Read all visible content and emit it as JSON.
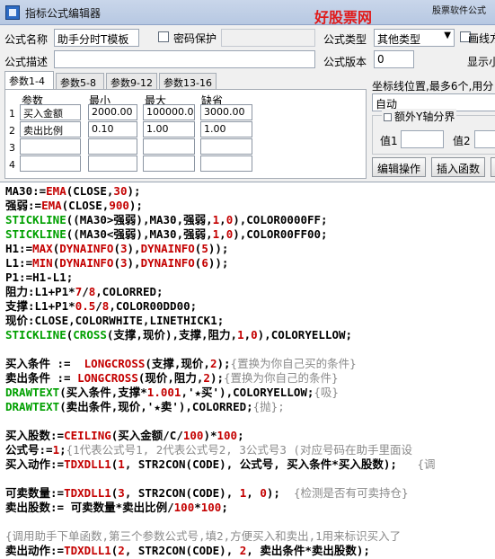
{
  "window": {
    "title": "指标公式编辑器",
    "brand_top": "股票软件公式",
    "brand": "好股票网Goodgupiao.com"
  },
  "form": {
    "name_label": "公式名称",
    "name_value": "助手分时T模板",
    "password_label": "密码保护",
    "type_label": "公式类型",
    "type_value": "其他类型",
    "draw_label": "画线方",
    "desc_label": "公式描述",
    "version_label": "公式版本",
    "version_value": "0",
    "display_label": "显示小"
  },
  "tabs": [
    "参数1-4",
    "参数5-8",
    "参数9-12",
    "参数13-16"
  ],
  "params": {
    "headers": [
      "参数",
      "最小",
      "最大",
      "缺省"
    ],
    "rows": [
      {
        "num": "1",
        "name": "买入金额",
        "min": "2000.00",
        "max": "100000.00",
        "default": "3000.00"
      },
      {
        "num": "2",
        "name": "卖出比例",
        "min": "0.10",
        "max": "1.00",
        "default": "1.00"
      },
      {
        "num": "3",
        "name": "",
        "min": "",
        "max": "",
        "default": ""
      },
      {
        "num": "4",
        "name": "",
        "min": "",
        "max": "",
        "default": ""
      }
    ]
  },
  "axis": {
    "label": "坐标线位置,最多6个,用分",
    "value": "自动",
    "group_label": "额外Y轴分界",
    "val1_label": "值1",
    "val2_label": "值2"
  },
  "buttons": {
    "edit_ops": "编辑操作",
    "insert_fn": "插入函数"
  },
  "code": [
    [
      [
        "MA30:=",
        "k"
      ],
      [
        "EMA",
        "f"
      ],
      [
        "(CLOSE,",
        "k"
      ],
      [
        "30",
        "n"
      ],
      [
        ");",
        "k"
      ]
    ],
    [
      [
        "强弱:=",
        "k"
      ],
      [
        "EMA",
        "f"
      ],
      [
        "(CLOSE,",
        "k"
      ],
      [
        "900",
        "n"
      ],
      [
        ");",
        "k"
      ]
    ],
    [
      [
        "STICKLINE",
        "g"
      ],
      [
        "((MA30>强弱),MA30,强弱,",
        "k"
      ],
      [
        "1",
        "n"
      ],
      [
        ",",
        "k"
      ],
      [
        "0",
        "n"
      ],
      [
        "),COLOR0000FF;",
        "k"
      ]
    ],
    [
      [
        "STICKLINE",
        "g"
      ],
      [
        "((MA30<强弱),MA30,强弱,",
        "k"
      ],
      [
        "1",
        "n"
      ],
      [
        ",",
        "k"
      ],
      [
        "0",
        "n"
      ],
      [
        "),COLOR00FF00;",
        "k"
      ]
    ],
    [
      [
        "H1:=",
        "k"
      ],
      [
        "MAX",
        "f"
      ],
      [
        "(",
        "k"
      ],
      [
        "DYNAINFO",
        "f"
      ],
      [
        "(",
        "k"
      ],
      [
        "3",
        "n"
      ],
      [
        "),",
        "k"
      ],
      [
        "DYNAINFO",
        "f"
      ],
      [
        "(",
        "k"
      ],
      [
        "5",
        "n"
      ],
      [
        "));",
        "k"
      ]
    ],
    [
      [
        "L1:=",
        "k"
      ],
      [
        "MIN",
        "f"
      ],
      [
        "(",
        "k"
      ],
      [
        "DYNAINFO",
        "f"
      ],
      [
        "(",
        "k"
      ],
      [
        "3",
        "n"
      ],
      [
        "),",
        "k"
      ],
      [
        "DYNAINFO",
        "f"
      ],
      [
        "(",
        "k"
      ],
      [
        "6",
        "n"
      ],
      [
        "));",
        "k"
      ]
    ],
    [
      [
        "P1:=H1-L1;",
        "k"
      ]
    ],
    [
      [
        "阻力:L1+P1*",
        "k"
      ],
      [
        "7",
        "n"
      ],
      [
        "/",
        "k"
      ],
      [
        "8",
        "n"
      ],
      [
        ",COLORRED;",
        "k"
      ]
    ],
    [
      [
        "支撑:L1+P1*",
        "k"
      ],
      [
        "0.5",
        "n"
      ],
      [
        "/",
        "k"
      ],
      [
        "8",
        "n"
      ],
      [
        ",COLOR00DD00;",
        "k"
      ]
    ],
    [
      [
        "现价:CLOSE,COLORWHITE,LINETHICK1;",
        "k"
      ]
    ],
    [
      [
        "STICKLINE",
        "g"
      ],
      [
        "(",
        "k"
      ],
      [
        "CROSS",
        "g"
      ],
      [
        "(支撑,现价),支撑,阻力,",
        "k"
      ],
      [
        "1",
        "n"
      ],
      [
        ",",
        "k"
      ],
      [
        "0",
        "n"
      ],
      [
        "),COLORYELLOW;",
        "k"
      ]
    ],
    [],
    [
      [
        "买入条件 :=  ",
        "k"
      ],
      [
        "LONGCROSS",
        "f"
      ],
      [
        "(支撑,现价,",
        "k"
      ],
      [
        "2",
        "n"
      ],
      [
        ");",
        "k"
      ],
      [
        "{置换为你自己买的条件}",
        "c"
      ]
    ],
    [
      [
        "卖出条件 := ",
        "k"
      ],
      [
        "LONGCROSS",
        "f"
      ],
      [
        "(现价,阻力,",
        "k"
      ],
      [
        "2",
        "n"
      ],
      [
        ");",
        "k"
      ],
      [
        "{置换为你自己的条件}",
        "c"
      ]
    ],
    [
      [
        "DRAWTEXT",
        "g"
      ],
      [
        "(买入条件,支撑*",
        "k"
      ],
      [
        "1.001",
        "n"
      ],
      [
        ",'★买'),COLORYELLOW;",
        "k"
      ],
      [
        "{吸}",
        "c"
      ]
    ],
    [
      [
        "DRAWTEXT",
        "g"
      ],
      [
        "(卖出条件,现价,'★卖'),COLORRED;",
        "k"
      ],
      [
        "{抛};",
        "c"
      ]
    ],
    [],
    [
      [
        "买入股数:=",
        "k"
      ],
      [
        "CEILING",
        "f"
      ],
      [
        "(买入金额/C/",
        "k"
      ],
      [
        "100",
        "n"
      ],
      [
        ")*",
        "k"
      ],
      [
        "100",
        "n"
      ],
      [
        ";",
        "k"
      ]
    ],
    [
      [
        "公式号:=",
        "k"
      ],
      [
        "1",
        "n"
      ],
      [
        ";",
        "k"
      ],
      [
        "{1代表公式号1, 2代表公式号2, 3公式号3 (对应号码在助手里面设",
        "c"
      ]
    ],
    [
      [
        "买入动作:=",
        "k"
      ],
      [
        "TDXDLL1",
        "f"
      ],
      [
        "(",
        "k"
      ],
      [
        "1",
        "n"
      ],
      [
        ", STR2CON(CODE), 公式号, 买入条件*买入股数);",
        "k"
      ],
      [
        "   {调",
        "c"
      ]
    ],
    [],
    [
      [
        "可卖数量:=",
        "k"
      ],
      [
        "TDXDLL1",
        "f"
      ],
      [
        "(",
        "k"
      ],
      [
        "3",
        "n"
      ],
      [
        ", STR2CON(CODE), ",
        "k"
      ],
      [
        "1",
        "n"
      ],
      [
        ", ",
        "k"
      ],
      [
        "0",
        "n"
      ],
      [
        "); ",
        "k"
      ],
      [
        " {检测是否有可卖持仓}",
        "c"
      ]
    ],
    [
      [
        "卖出股数:= 可卖数量*卖出比例/",
        "k"
      ],
      [
        "100",
        "n"
      ],
      [
        "*",
        "k"
      ],
      [
        "100",
        "n"
      ],
      [
        ";",
        "k"
      ]
    ],
    [],
    [
      [
        "{调用助手下单函数,第三个参数公式号,填2,方便买入和卖出,1用来标识买入了",
        "c"
      ]
    ],
    [
      [
        "卖出动作:=",
        "k"
      ],
      [
        "TDXDLL1",
        "f"
      ],
      [
        "(",
        "k"
      ],
      [
        "2",
        "n"
      ],
      [
        ", STR2CON(CODE), ",
        "k"
      ],
      [
        "2",
        "n"
      ],
      [
        ", 卖出条件*卖出股数);",
        "k"
      ]
    ]
  ],
  "colors": {
    "function": "#c40000",
    "number": "#c40000",
    "drawing": "#00a000",
    "comment": "#8a8a8a",
    "brand": "#e01b1b"
  }
}
